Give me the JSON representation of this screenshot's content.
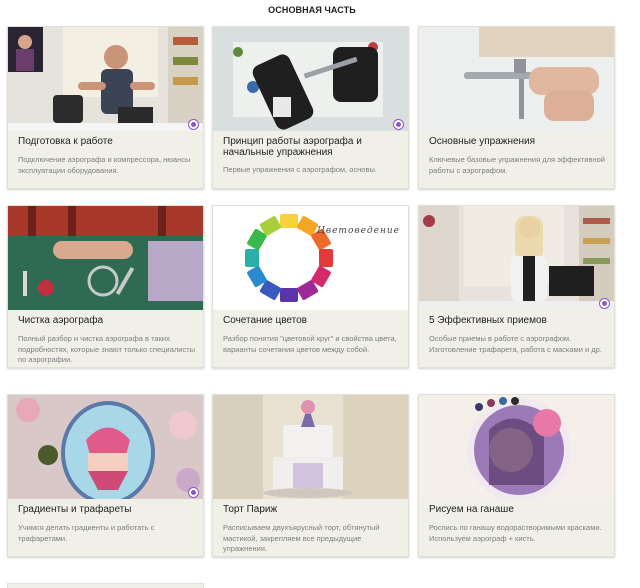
{
  "section": {
    "title": "ОСНОВНАЯ ЧАСТЬ"
  },
  "cards": [
    {
      "title": "Подготовка к работе",
      "desc": "Подключение аэрографа и компрессора, нюансы эксплуатации оборудования."
    },
    {
      "title": "Принцип работы аэрографа и начальные упражнения",
      "desc": "Первые упражнения с аэрографом, основы."
    },
    {
      "title": "Основные упражнения",
      "desc": "Ключевые базовые упражнения для эффективной работы с аэрографом."
    },
    {
      "title": "Чистка аэрографа",
      "desc": "Полный разбор и чистка аэрографа в таких подробностях, которые знают только специалисты по аэрографии."
    },
    {
      "title": "Сочетание цветов",
      "desc": "Разбор понятия \"цветовой круг\" и свойства цвета, варианты сочетания цветов между собой.",
      "image_caption": "Цветоведение"
    },
    {
      "title": "5 Эффективных приемов",
      "desc": "Особые приемы в работе с аэрографом. Изготовление трафарета, работа с масками и др."
    },
    {
      "title": "Градиенты и трафареты",
      "desc": "Учимся делать градиенты и работать с трафаретами."
    },
    {
      "title": "Торт Париж",
      "desc": "Расписываем двухъярусный торт, обтянутый мастикой, закрепляем все предыдущие упражнения."
    },
    {
      "title": "Рисуем на ганаше",
      "desc": "Роспись по ганашу водорастворимыми красками. Используем аэрограф + кисть."
    }
  ],
  "colors": {
    "card_bg": "#f1f0e8",
    "badge_accent": "#8b56c6",
    "text_title": "#222222",
    "text_desc": "#7d7d7d"
  },
  "icons": {
    "badge": "play-badge-icon"
  }
}
